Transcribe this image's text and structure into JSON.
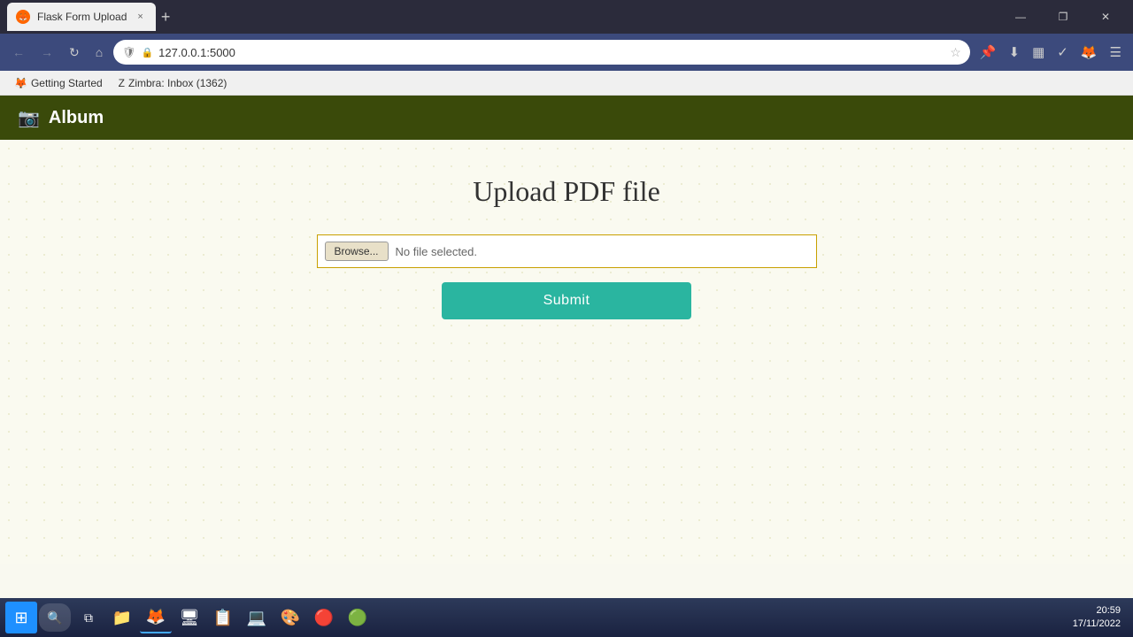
{
  "browser": {
    "tab_title": "Flask Form Upload",
    "tab_close": "×",
    "tab_new": "+",
    "url": "127.0.0.1:5000",
    "btn_minimize": "—",
    "btn_restore": "❐",
    "btn_close": "✕",
    "btn_back": "←",
    "btn_forward": "→",
    "btn_refresh": "↻",
    "btn_home": "⌂",
    "btn_hamburger": "☰"
  },
  "bookmarks": [
    {
      "label": "Getting Started",
      "icon": "🦊"
    },
    {
      "label": "Zimbra: Inbox (1362)",
      "icon": "Z"
    }
  ],
  "app": {
    "icon": "📷",
    "title": "Album"
  },
  "page": {
    "title": "Upload PDF file",
    "browse_label": "Browse...",
    "file_placeholder": "No file selected.",
    "submit_label": "Submit"
  },
  "taskbar": {
    "clock_time": "20:59",
    "clock_date": "17/11/2022"
  },
  "taskbar_icons": [
    {
      "name": "windows-start",
      "char": "⊞",
      "color": "#1e90ff"
    },
    {
      "name": "search",
      "char": "🔍"
    },
    {
      "name": "task-view",
      "char": "⧉"
    },
    {
      "name": "explorer",
      "char": "📁"
    },
    {
      "name": "firefox",
      "char": "🦊"
    },
    {
      "name": "app1",
      "char": "🖥"
    },
    {
      "name": "app2",
      "char": "📋"
    },
    {
      "name": "app3",
      "char": "💻"
    },
    {
      "name": "app4",
      "char": "🎨"
    },
    {
      "name": "app5",
      "char": "🔴"
    },
    {
      "name": "app6",
      "char": "🟢"
    }
  ]
}
